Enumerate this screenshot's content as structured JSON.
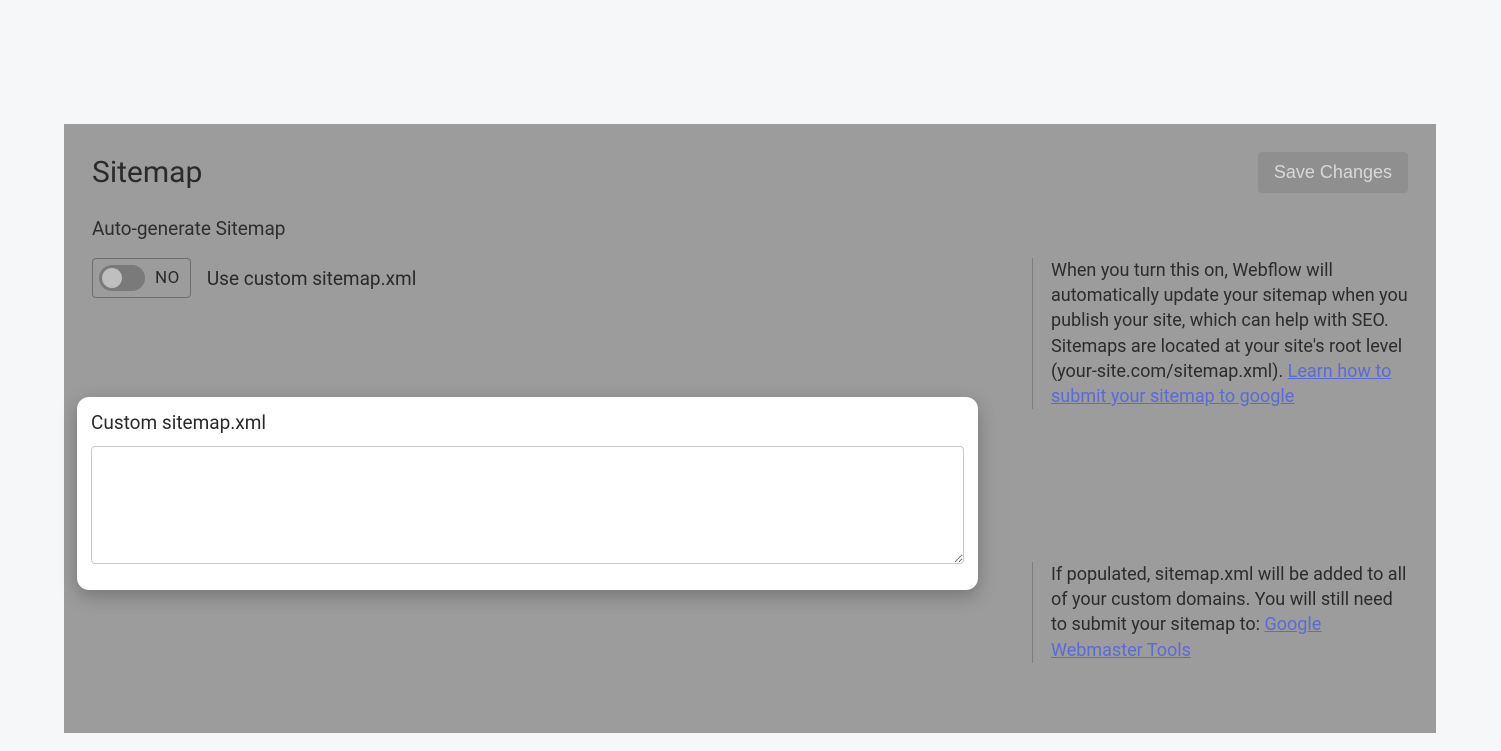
{
  "panel": {
    "title": "Sitemap",
    "save_button": "Save Changes"
  },
  "autogen": {
    "heading": "Auto-generate Sitemap",
    "toggle_state": "NO",
    "toggle_label": "Use custom sitemap.xml",
    "help_text": "When you turn this on, Webflow will automatically update your sitemap when you publish your site, which can help with SEO. Sitemaps are located at your site's root level (your-site.com/sitemap.xml). ",
    "help_link": "Learn how to submit your sitemap to google"
  },
  "custom": {
    "heading": "Custom sitemap.xml",
    "textarea_value": "",
    "help_text": "If populated, sitemap.xml will be added to all of your custom domains. You will still need to submit your sitemap to: ",
    "help_link": "Google Webmaster Tools"
  }
}
